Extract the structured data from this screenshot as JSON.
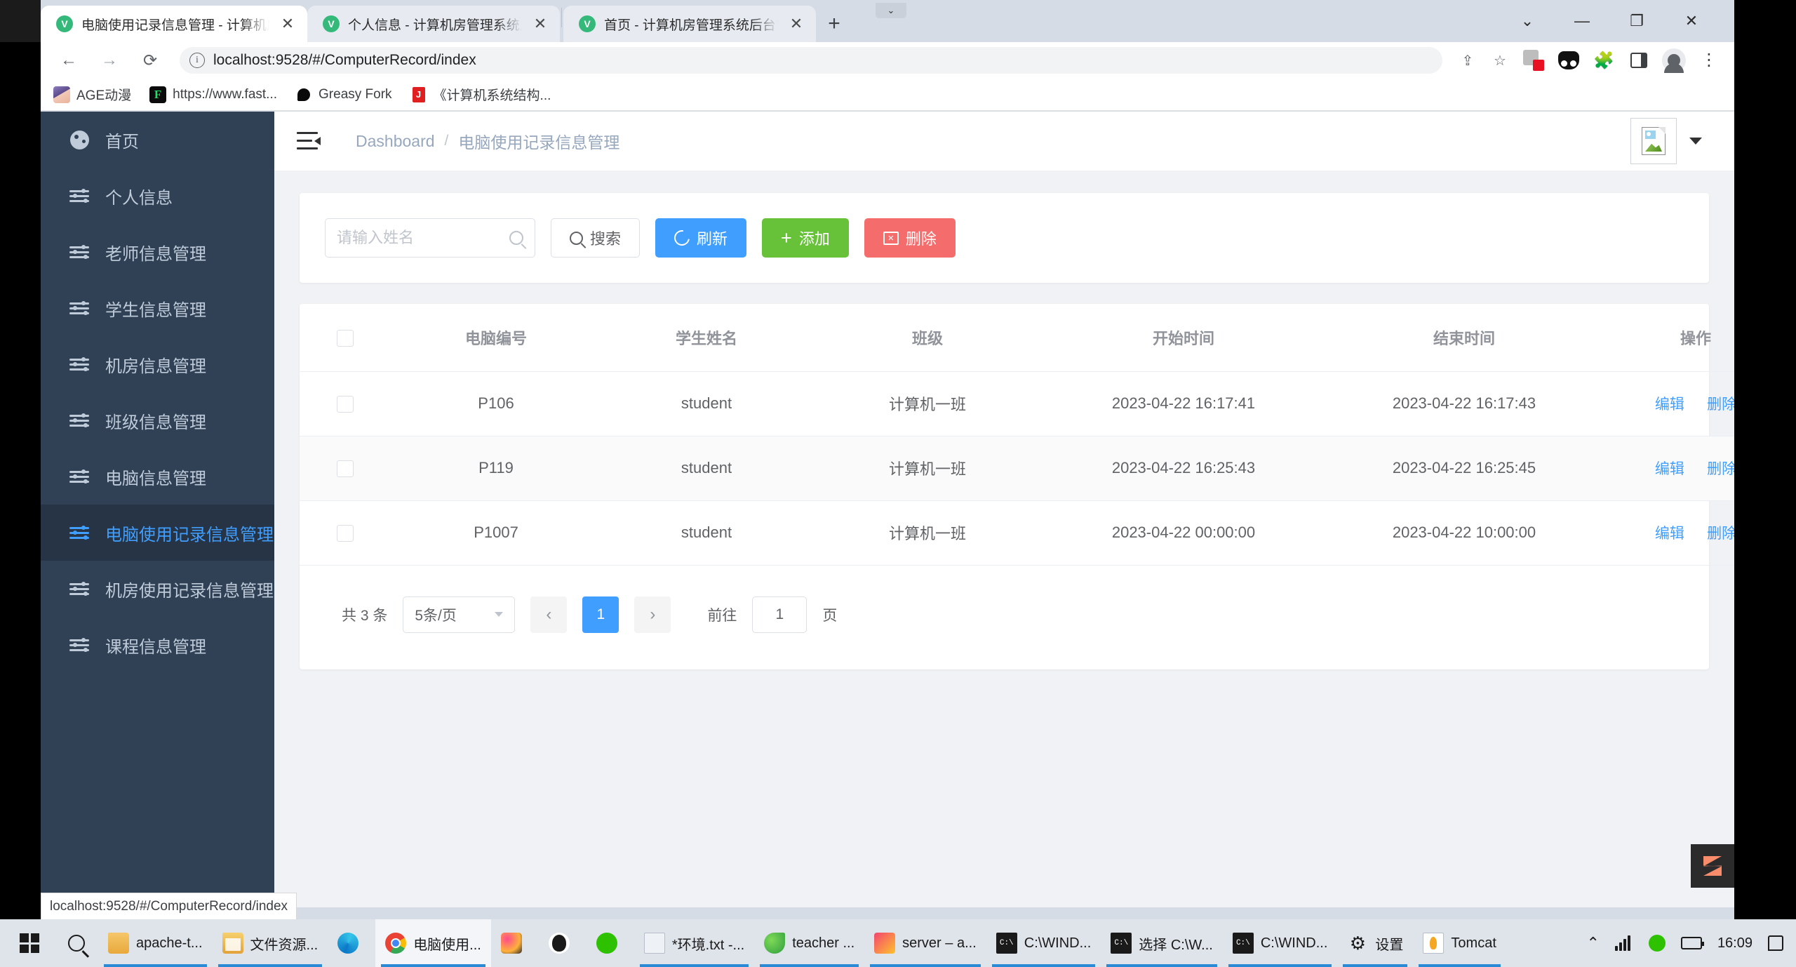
{
  "browser": {
    "tabs": [
      {
        "title": "电脑使用记录信息管理 - 计算机房管理系统后台管理",
        "active": true
      },
      {
        "title": "个人信息 - 计算机房管理系统后台管理",
        "active": false
      },
      {
        "title": "首页 - 计算机房管理系统后台管理",
        "active": false
      }
    ],
    "new_tab_label": "+",
    "close_label": "✕",
    "url": "localhost:9528/#/ComputerRecord/index",
    "window_controls": {
      "chevron": "⌄",
      "minimize": "—",
      "maximize": "❐",
      "close": "✕"
    },
    "bookmarks": [
      {
        "label": "AGE动漫"
      },
      {
        "label": "https://www.fast..."
      },
      {
        "label": "Greasy Fork"
      },
      {
        "label": "《计算机系统结构..."
      }
    ],
    "status_text": "localhost:9528/#/ComputerRecord/index"
  },
  "sidebar": {
    "items": [
      {
        "label": "首页",
        "icon": "dashboard-icon",
        "active": false
      },
      {
        "label": "个人信息",
        "icon": "sliders-icon",
        "active": false
      },
      {
        "label": "老师信息管理",
        "icon": "sliders-icon",
        "active": false
      },
      {
        "label": "学生信息管理",
        "icon": "sliders-icon",
        "active": false
      },
      {
        "label": "机房信息管理",
        "icon": "sliders-icon",
        "active": false
      },
      {
        "label": "班级信息管理",
        "icon": "sliders-icon",
        "active": false
      },
      {
        "label": "电脑信息管理",
        "icon": "sliders-icon",
        "active": false
      },
      {
        "label": "电脑使用记录信息管理",
        "icon": "sliders-icon",
        "active": true
      },
      {
        "label": "机房使用记录信息管理",
        "icon": "sliders-icon",
        "active": false
      },
      {
        "label": "课程信息管理",
        "icon": "sliders-icon",
        "active": false
      }
    ]
  },
  "navbar": {
    "breadcrumb_root": "Dashboard",
    "breadcrumb_sep": "/",
    "breadcrumb_current": "电脑使用记录信息管理"
  },
  "toolbar": {
    "search_placeholder": "请输入姓名",
    "search_value": "",
    "search_button": "搜索",
    "refresh_button": "刷新",
    "add_button": "添加",
    "delete_button": "删除"
  },
  "table": {
    "columns": [
      "电脑编号",
      "学生姓名",
      "班级",
      "开始时间",
      "结束时间",
      "操作"
    ],
    "rows": [
      {
        "computer_id": "P106",
        "student": "student",
        "class": "计算机一班",
        "start": "2023-04-22 16:17:41",
        "end": "2023-04-22 16:17:43",
        "edit": "编辑",
        "delete": "删除",
        "striped": false
      },
      {
        "computer_id": "P119",
        "student": "student",
        "class": "计算机一班",
        "start": "2023-04-22 16:25:43",
        "end": "2023-04-22 16:25:45",
        "edit": "编辑",
        "delete": "删除",
        "striped": true
      },
      {
        "computer_id": "P1007",
        "student": "student",
        "class": "计算机一班",
        "start": "2023-04-22 00:00:00",
        "end": "2023-04-22 10:00:00",
        "edit": "编辑",
        "delete": "删除",
        "striped": false
      }
    ]
  },
  "pagination": {
    "total_text": "共 3 条",
    "page_size": "5条/页",
    "prev": "‹",
    "next": "›",
    "current_page": "1",
    "goto_label": "前往",
    "goto_value": "1",
    "page_unit": "页"
  },
  "taskbar": {
    "items": [
      {
        "label": "apache-t...",
        "icon": "folder-icon"
      },
      {
        "label": "文件资源...",
        "icon": "file-explorer-icon"
      },
      {
        "label": "",
        "icon": "edge-icon"
      },
      {
        "label": "电脑使用...",
        "icon": "chrome-icon",
        "active": true
      },
      {
        "label": "",
        "icon": "idea-icon"
      },
      {
        "label": "",
        "icon": "qq-icon"
      },
      {
        "label": "",
        "icon": "wechat-icon"
      },
      {
        "label": "*环境.txt -...",
        "icon": "notepad-icon"
      },
      {
        "label": "teacher ...",
        "icon": "leaf-icon"
      },
      {
        "label": "server – a...",
        "icon": "idea-project-icon"
      },
      {
        "label": "C:\\WIND...",
        "icon": "cmd-icon"
      },
      {
        "label": "选择 C:\\W...",
        "icon": "cmd-icon"
      },
      {
        "label": "C:\\WIND...",
        "icon": "cmd-icon"
      },
      {
        "label": "设置",
        "icon": "gear-icon"
      },
      {
        "label": "Tomcat",
        "icon": "tomcat-icon"
      }
    ],
    "tray": {
      "chevron": "⌃",
      "clock": "16:09"
    }
  },
  "colors": {
    "sidebar_bg": "#304156",
    "sidebar_active_bg": "#263445",
    "primary": "#409EFF",
    "success": "#67C23A",
    "danger": "#F56C6C",
    "page_bg": "#F0F2F5"
  }
}
